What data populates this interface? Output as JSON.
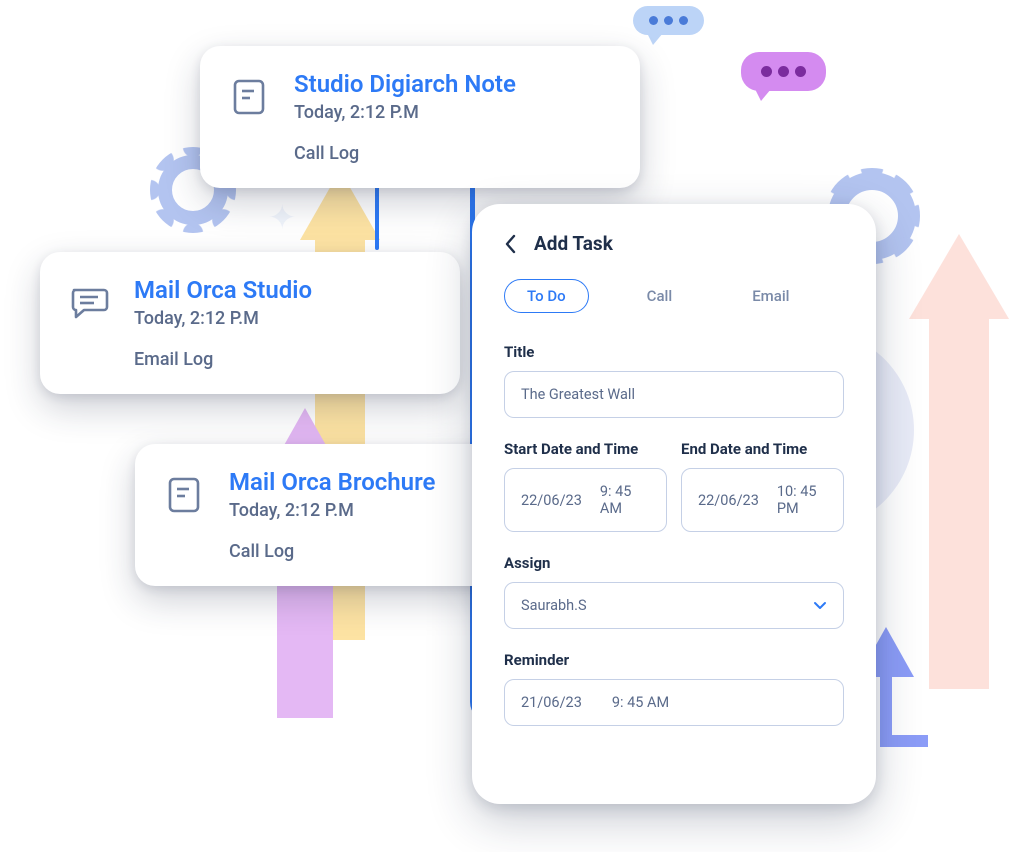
{
  "cards": [
    {
      "title": "Studio Digiarch Note",
      "time": "Today, 2:12 P.M",
      "log": "Call Log",
      "icon": "note"
    },
    {
      "title": "Mail Orca Studio",
      "time": "Today, 2:12 P.M",
      "log": "Email Log",
      "icon": "chat"
    },
    {
      "title": "Mail Orca Brochure",
      "time": "Today, 2:12 P.M",
      "log": "Call Log",
      "icon": "note"
    }
  ],
  "panel": {
    "title": "Add Task",
    "tabs": [
      "To Do",
      "Call",
      "Email"
    ],
    "activeTab": "To Do",
    "fields": {
      "titleLabel": "Title",
      "titleValue": "The Greatest Wall",
      "startLabel": "Start Date and Time",
      "startDate": "22/06/23",
      "startTime": "9: 45 AM",
      "endLabel": "End Date and Time",
      "endDate": "22/06/23",
      "endTime": "10: 45 PM",
      "assignLabel": "Assign",
      "assignValue": "Saurabh.S",
      "reminderLabel": "Reminder",
      "reminderDate": "21/06/23",
      "reminderTime": "9: 45 AM"
    }
  }
}
